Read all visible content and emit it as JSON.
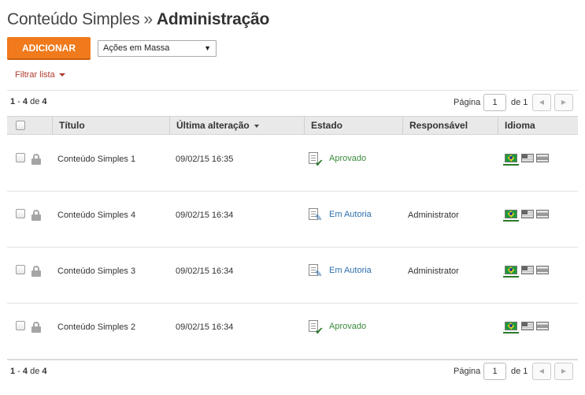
{
  "header": {
    "section": "Conteúdo Simples",
    "separator": "»",
    "page": "Administração"
  },
  "toolbar": {
    "add_label": "ADICIONAR",
    "mass_actions_selected": "Ações em Massa",
    "filter_label": "Filtrar lista"
  },
  "pagination_top": {
    "range_start": "1",
    "range_sep": " - ",
    "range_end": "4",
    "of_word": " de ",
    "total": "4",
    "page_label": "Página",
    "page_value": "1",
    "page_of": "de 1",
    "prev_icon": "chevron-left-icon",
    "next_icon": "chevron-right-icon"
  },
  "pagination_bottom": {
    "range_start": "1",
    "range_sep": " - ",
    "range_end": "4",
    "of_word": " de ",
    "total": "4",
    "page_label": "Página",
    "page_value": "1",
    "page_of": "de 1"
  },
  "table": {
    "columns": {
      "title": "Título",
      "modified": "Última alteração",
      "status": "Estado",
      "owner": "Responsável",
      "language": "Idioma"
    },
    "rows": [
      {
        "title": "Conteúdo Simples 1",
        "modified": "09/02/15 16:35",
        "status": "Aprovado",
        "status_kind": "approved",
        "owner": ""
      },
      {
        "title": "Conteúdo Simples 4",
        "modified": "09/02/15 16:34",
        "status": "Em Autoria",
        "status_kind": "authoring",
        "owner": "Administrator"
      },
      {
        "title": "Conteúdo Simples 3",
        "modified": "09/02/15 16:34",
        "status": "Em Autoria",
        "status_kind": "authoring",
        "owner": "Administrator"
      },
      {
        "title": "Conteúdo Simples 2",
        "modified": "09/02/15 16:34",
        "status": "Aprovado",
        "status_kind": "approved",
        "owner": ""
      }
    ]
  },
  "colors": {
    "accent": "#f07a1c",
    "filter_link": "#b03a2e",
    "approved": "#3b8a3b",
    "authoring": "#2f6fad"
  },
  "icons": {
    "lock": "lock-icon",
    "approved": "document-check-icon",
    "authoring": "document-edit-icon",
    "flags": [
      "flag-brazil-icon",
      "flag-usa-icon",
      "flag-spain-icon"
    ]
  }
}
